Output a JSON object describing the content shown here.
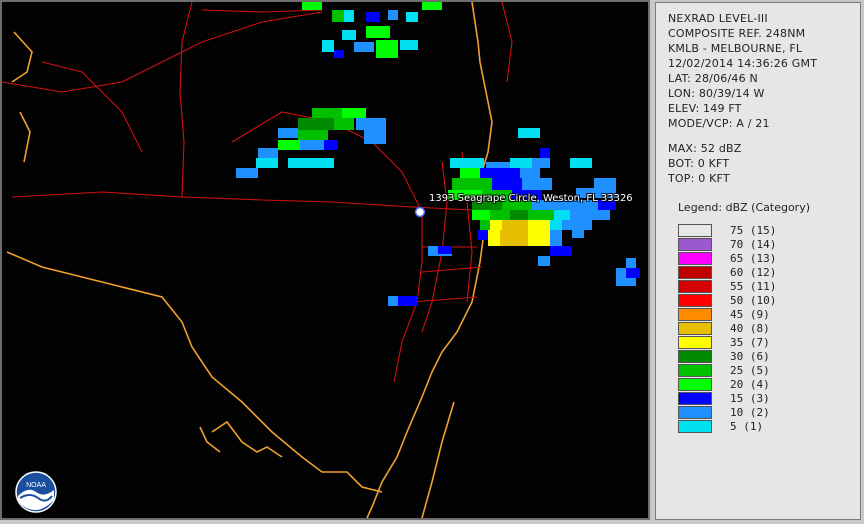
{
  "header": {
    "product": "NEXRAD LEVEL-III",
    "type": "COMPOSITE REF. 248NM",
    "station": "KMLB - MELBOURNE, FL",
    "datetime": "12/02/2014 14:36:26 GMT",
    "lat": "LAT: 28/06/46 N",
    "lon": "LON: 80/39/14 W",
    "elev": "ELEV: 149 FT",
    "mode": "MODE/VCP: A / 21"
  },
  "stats": {
    "max": "MAX: 52 dBZ",
    "bot": "BOT: 0 KFT",
    "top": "TOP: 0 KFT"
  },
  "legend": {
    "title": "Legend: dBZ (Category)",
    "items": [
      {
        "label": "75  (15)",
        "color": "#e8e8e8"
      },
      {
        "label": "70  (14)",
        "color": "#9b59d0"
      },
      {
        "label": "65  (13)",
        "color": "#ff00ff"
      },
      {
        "label": "60  (12)",
        "color": "#c00000"
      },
      {
        "label": "55  (11)",
        "color": "#d40000"
      },
      {
        "label": "50  (10)",
        "color": "#ff0000"
      },
      {
        "label": "45  (9)",
        "color": "#ff8c00"
      },
      {
        "label": "40  (8)",
        "color": "#e6c000"
      },
      {
        "label": "35  (7)",
        "color": "#ffff00"
      },
      {
        "label": "30  (6)",
        "color": "#008a00"
      },
      {
        "label": "25  (5)",
        "color": "#00c000"
      },
      {
        "label": "20  (4)",
        "color": "#00ff00"
      },
      {
        "label": "15  (3)",
        "color": "#0000ff"
      },
      {
        "label": "10  (2)",
        "color": "#1e90ff"
      },
      {
        "label": "5  (1)",
        "color": "#00e0f0"
      }
    ]
  },
  "map": {
    "location_label": "1393 Seagrape Circle, Weston, FL 33326",
    "marker_icon": "location-pin-icon",
    "logo_text": "NOAA"
  }
}
